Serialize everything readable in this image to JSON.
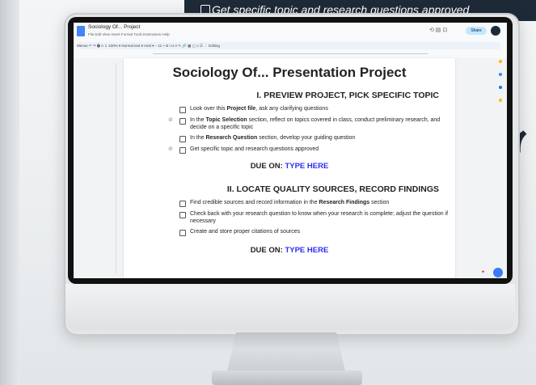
{
  "background": {
    "strip_text": "Get specific topic and research questions approved"
  },
  "docs": {
    "title": "Sociology Of... Project",
    "menus": "File  Edit  View  Insert  Format  Tools  Extensions  Help",
    "share_label": "Share",
    "toolbar_text": "Menus   ↶  ↷  🖶  A  ⇩  100%  ▾   Normal text  ▾   Arial  ▾   −  11  +   B  I  U  A  ✎   🔗  ▦  ▢   ≡  ☰  ⋮   Editing"
  },
  "document": {
    "main_title": "Sociology Of... Presentation Project",
    "section1": {
      "heading": "I. PREVIEW PROJECT, PICK SPECIFIC TOPIC",
      "tasks": [
        {
          "pre": "Look over this ",
          "bold": "Project file",
          "post": ", ask any clarifying questions"
        },
        {
          "pre": "In the ",
          "bold": "Topic Selection",
          "post": " section, reflect on topics covered in class, conduct preliminary research, and decide on a specific topic"
        },
        {
          "pre": "In the ",
          "bold": "Research Question",
          "post": " section, develop your guiding question"
        },
        {
          "pre": "Get specific topic and research questions approved",
          "bold": "",
          "post": ""
        }
      ],
      "due_label": "DUE ON: ",
      "due_value": "TYPE HERE"
    },
    "section2": {
      "heading": "II. LOCATE QUALITY SOURCES, RECORD FINDINGS",
      "tasks": [
        {
          "pre": "Find credible sources and record information in the ",
          "bold": "Research Findings",
          "post": " section"
        },
        {
          "pre": "Check back with your research question to know when your research is complete; adjust the question if necessary",
          "bold": "",
          "post": ""
        },
        {
          "pre": "Create and store proper citations of sources",
          "bold": "",
          "post": ""
        }
      ],
      "due_label": "DUE ON: ",
      "due_value": "TYPE HERE"
    }
  },
  "colors": {
    "accent_blue": "#2d2df5",
    "docs_blue": "#4285f4",
    "strip_navy": "#1f2a38"
  }
}
